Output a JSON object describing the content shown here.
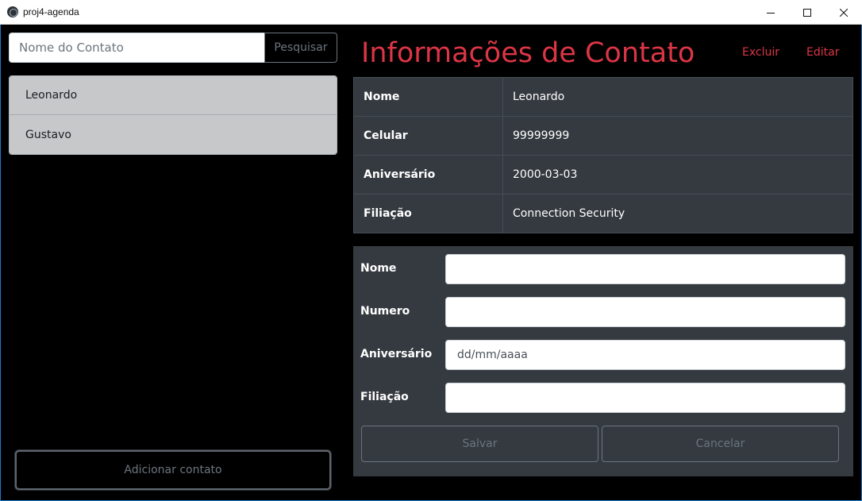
{
  "window": {
    "title": "proj4-agenda",
    "controls": [
      "minimize-icon",
      "maximize-icon",
      "close-icon"
    ]
  },
  "sidebar": {
    "search_placeholder": "Nome do Contato",
    "search_button": "Pesquisar",
    "contacts": [
      "Leonardo",
      "Gustavo"
    ],
    "add_button": "Adicionar contato"
  },
  "main": {
    "title": "Informações de Contato",
    "delete_link": "Excluir",
    "edit_link": "Editar",
    "info": [
      {
        "label": "Nome",
        "value": "Leonardo"
      },
      {
        "label": "Celular",
        "value": "99999999"
      },
      {
        "label": "Aniversário",
        "value": "2000-03-03"
      },
      {
        "label": "Filiação",
        "value": "Connection Security"
      }
    ],
    "form": {
      "name_label": "Nome",
      "name_value": "",
      "number_label": "Numero",
      "number_value": "",
      "birthday_label": "Aniversário",
      "birthday_placeholder": "dd/mm/aaaa",
      "affiliation_label": "Filiação",
      "affiliation_value": "",
      "save_button": "Salvar",
      "cancel_button": "Cancelar"
    }
  },
  "colors": {
    "accent": "#dc3545",
    "panel": "#343a40",
    "background": "#000000"
  }
}
